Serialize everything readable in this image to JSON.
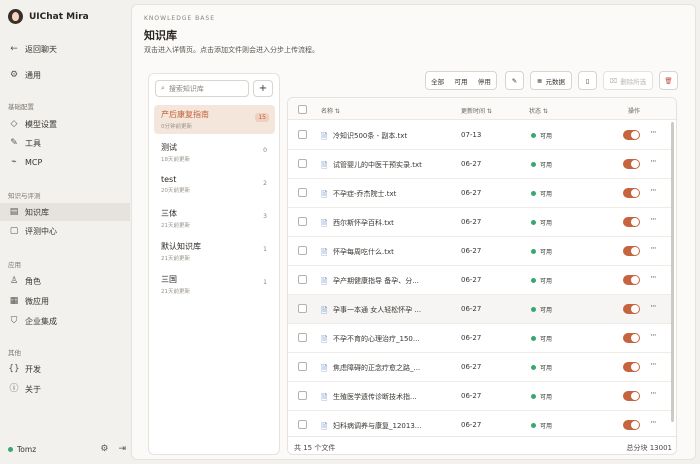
{
  "app": {
    "name": "UIChat Mira"
  },
  "sidebar": {
    "back_label": "返回聊天",
    "general_label": "通用",
    "sections": {
      "basic": "基础配置",
      "kb_eval": "知识与评测",
      "apps": "应用",
      "other": "其他"
    },
    "items": {
      "model": "模型设置",
      "tools": "工具",
      "mcp": "MCP",
      "kb": "知识库",
      "eval": "评测中心",
      "role": "角色",
      "mini_app": "微应用",
      "enterprise": "企业集成",
      "dev": "开发",
      "about": "关于"
    },
    "user": "Tomz"
  },
  "page": {
    "eyebrow": "KNOWLEDGE BASE",
    "title": "知识库",
    "description": "双击进入详情页。点击添加文件则会进入分步上传流程。"
  },
  "kb_list": {
    "search_placeholder": "搜索知识库",
    "add_icon": "plus-icon",
    "items": [
      {
        "name": "产后康复指南",
        "sub": "0分钟前更新",
        "count": "15",
        "active": true
      },
      {
        "name": "测试",
        "sub": "18天前更新",
        "count": "0",
        "active": false
      },
      {
        "name": "test",
        "sub": "20天前更新",
        "count": "2",
        "active": false
      },
      {
        "name": "三体",
        "sub": "21天前更新",
        "count": "3",
        "active": false
      },
      {
        "name": "默认知识库",
        "sub": "21天前更新",
        "count": "1",
        "active": false
      },
      {
        "name": "三国",
        "sub": "21天前更新",
        "count": "1",
        "active": false
      }
    ]
  },
  "toolbar": {
    "filter_all": "全部",
    "filter_enabled": "可用",
    "filter_disabled": "停用",
    "metadata": "元数据",
    "delete_selected": "删除所选"
  },
  "table": {
    "headers": {
      "name": "名称",
      "updated": "更新时间",
      "status": "状态",
      "action": "操作"
    },
    "rows": [
      {
        "name": "冷知识500条 - 副本.txt",
        "updated": "07-13",
        "status": "可用"
      },
      {
        "name": "试管婴儿的中医干预实录.txt",
        "updated": "06-27",
        "status": "可用"
      },
      {
        "name": "不孕症-乔杰院士.txt",
        "updated": "06-27",
        "status": "可用"
      },
      {
        "name": "西尔斯怀孕百科.txt",
        "updated": "06-27",
        "status": "可用"
      },
      {
        "name": "怀孕每周吃什么.txt",
        "updated": "06-27",
        "status": "可用"
      },
      {
        "name": "孕产期健康指导 备孕、分...",
        "updated": "06-27",
        "status": "可用"
      },
      {
        "name": "孕事一本通 女人轻松怀孕 ...",
        "updated": "06-27",
        "status": "可用"
      },
      {
        "name": "不孕不育的心理治疗_150...",
        "updated": "06-27",
        "status": "可用"
      },
      {
        "name": "焦虑障碍的正念疗愈之路_...",
        "updated": "06-27",
        "status": "可用"
      },
      {
        "name": "生殖医学遗传诊断技术指...",
        "updated": "06-27",
        "status": "可用"
      },
      {
        "name": "妇科病调养与康复_12013...",
        "updated": "06-27",
        "status": "可用"
      }
    ],
    "footer_total": "共 15 个文件",
    "footer_chunks": "总分块 13001"
  },
  "colors": {
    "accent": "#c5643f",
    "status_green": "#3aa76d"
  }
}
